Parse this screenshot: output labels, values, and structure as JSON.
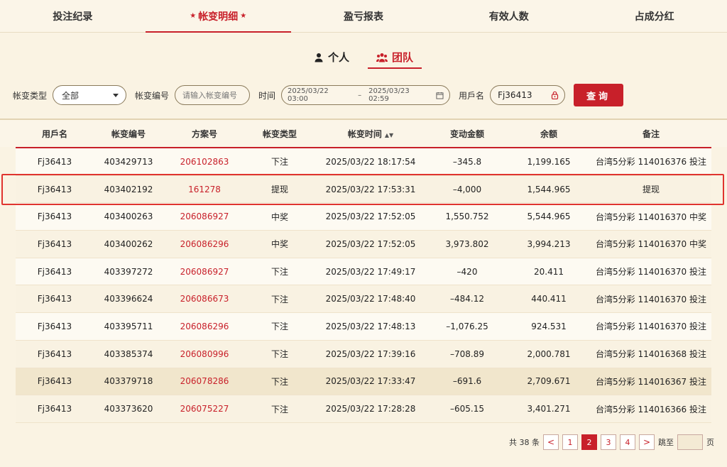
{
  "tabs": [
    "投注纪录",
    "帐变明细",
    "盈亏报表",
    "有效人数",
    "占成分红"
  ],
  "active_tab_index": 1,
  "subtabs": {
    "personal": "个人",
    "team": "团队"
  },
  "filters": {
    "type_label": "帐变类型",
    "type_value": "全部",
    "number_label": "帐变编号",
    "number_placeholder": "请输入帐变编号",
    "time_label": "时间",
    "time_start": "2025/03/22 03:00",
    "time_sep": "–",
    "time_end": "2025/03/23 02:59",
    "user_label": "用戶名",
    "user_value": "Fj36413",
    "query_button": "查询"
  },
  "table": {
    "headers": [
      "用戶名",
      "帐变编号",
      "方案号",
      "帐变类型",
      "帐变时间",
      "变动金额",
      "余额",
      "备注"
    ],
    "rows": [
      [
        "Fj36413",
        "403429713",
        "206102863",
        "下注",
        "2025/03/22 18:17:54",
        "–345.8",
        "1,199.165",
        "台湾5分彩 114016376 投注"
      ],
      [
        "Fj36413",
        "403402192",
        "161278",
        "提现",
        "2025/03/22 17:53:31",
        "–4,000",
        "1,544.965",
        "提现"
      ],
      [
        "Fj36413",
        "403400263",
        "206086927",
        "中奖",
        "2025/03/22 17:52:05",
        "1,550.752",
        "5,544.965",
        "台湾5分彩 114016370 中奖"
      ],
      [
        "Fj36413",
        "403400262",
        "206086296",
        "中奖",
        "2025/03/22 17:52:05",
        "3,973.802",
        "3,994.213",
        "台湾5分彩 114016370 中奖"
      ],
      [
        "Fj36413",
        "403397272",
        "206086927",
        "下注",
        "2025/03/22 17:49:17",
        "–420",
        "20.411",
        "台湾5分彩 114016370 投注"
      ],
      [
        "Fj36413",
        "403396624",
        "206086673",
        "下注",
        "2025/03/22 17:48:40",
        "–484.12",
        "440.411",
        "台湾5分彩 114016370 投注"
      ],
      [
        "Fj36413",
        "403395711",
        "206086296",
        "下注",
        "2025/03/22 17:48:13",
        "–1,076.25",
        "924.531",
        "台湾5分彩 114016370 投注"
      ],
      [
        "Fj36413",
        "403385374",
        "206080996",
        "下注",
        "2025/03/22 17:39:16",
        "–708.89",
        "2,000.781",
        "台湾5分彩 114016368 投注"
      ],
      [
        "Fj36413",
        "403379718",
        "206078286",
        "下注",
        "2025/03/22 17:33:47",
        "–691.6",
        "2,709.671",
        "台湾5分彩 114016367 投注"
      ],
      [
        "Fj36413",
        "403373620",
        "206075227",
        "下注",
        "2025/03/22 17:28:28",
        "–605.15",
        "3,401.271",
        "台湾5分彩 114016366 投注"
      ]
    ]
  },
  "pager": {
    "total": "共 38 条",
    "prev": "<",
    "pages": [
      "1",
      "2",
      "3",
      "4"
    ],
    "current_page": "2",
    "next": ">",
    "jump_label": "跳至",
    "page_suffix": "页"
  },
  "colors": {
    "accent": "#c8202a",
    "background": "#faf3e3",
    "highlight": "#e0342f"
  }
}
